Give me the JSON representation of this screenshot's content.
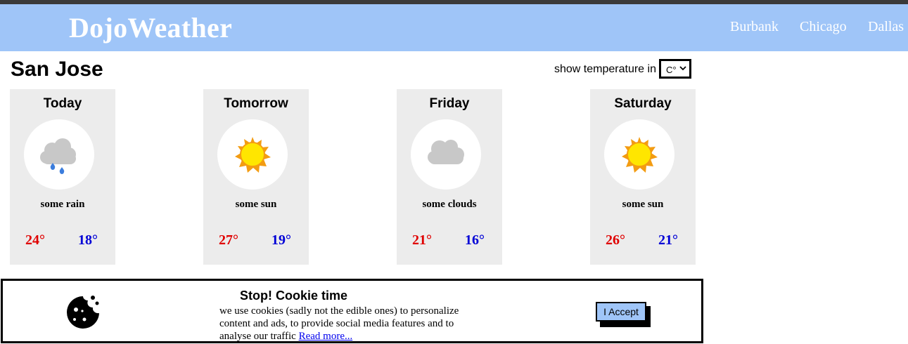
{
  "header": {
    "logo": "DojoWeather",
    "nav": [
      "Burbank",
      "Chicago",
      "Dallas"
    ]
  },
  "city": "San Jose",
  "unit": {
    "label": "show temperature in",
    "selected": "C°"
  },
  "forecast": [
    {
      "day": "Today",
      "icon": "rain-cloud-icon",
      "desc": "some rain",
      "high": "24°",
      "low": "18°"
    },
    {
      "day": "Tomorrow",
      "icon": "sun-icon",
      "desc": "some sun",
      "high": "27°",
      "low": "19°"
    },
    {
      "day": "Friday",
      "icon": "cloud-icon",
      "desc": "some clouds",
      "high": "21°",
      "low": "16°"
    },
    {
      "day": "Saturday",
      "icon": "sun-icon",
      "desc": "some sun",
      "high": "26°",
      "low": "21°"
    }
  ],
  "cookie": {
    "icon": "cookie-icon",
    "title": "Stop! Cookie time",
    "text": "we use cookies (sadly not the edible ones) to personalize content and ads, to provide social media features and to analyse our traffic",
    "link": "Read more...",
    "button": "I Accept"
  },
  "colors": {
    "header_bg": "#9fc5f8",
    "high": "#e00000",
    "low": "#0000d6",
    "card_bg": "#ececec"
  }
}
